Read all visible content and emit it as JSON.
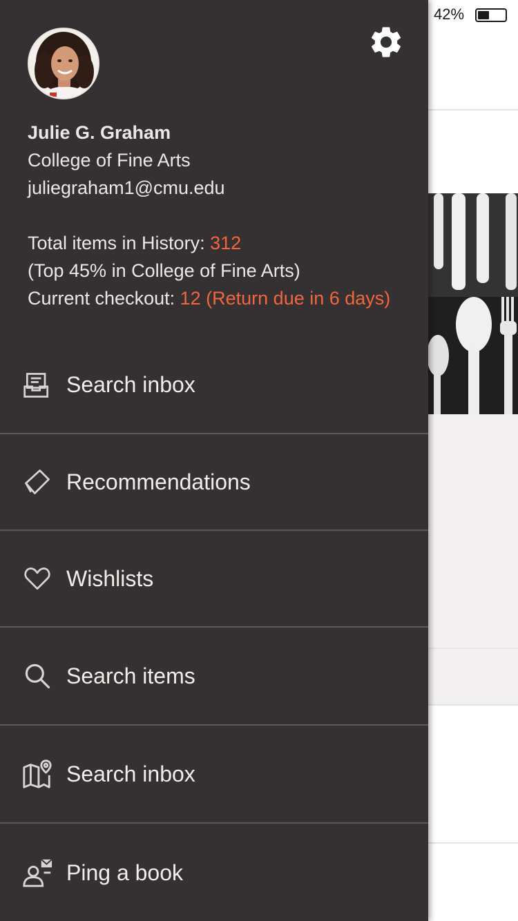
{
  "status_bar": {
    "battery_percent_text": "42%",
    "battery_level": 0.42
  },
  "drawer": {
    "settings_icon": "gear-icon",
    "profile": {
      "name": "Julie G. Graham",
      "college": "College of Fine Arts",
      "email": "juliegraham1@cmu.edu",
      "history_label": "Total items in History: ",
      "history_count": "312",
      "rank_text": "(Top 45% in College of Fine Arts)",
      "checkout_label": "Current checkout: ",
      "checkout_value": "12 (Return due in 6 days)"
    },
    "menu": [
      {
        "label": "Search inbox",
        "icon": "inbox-icon"
      },
      {
        "label": "Recommendations",
        "icon": "tag-icon"
      },
      {
        "label": "Wishlists",
        "icon": "heart-icon"
      },
      {
        "label": "Search items",
        "icon": "search-icon"
      },
      {
        "label": "Search inbox",
        "icon": "map-icon"
      },
      {
        "label": "Ping a book",
        "icon": "person-mail-icon"
      }
    ]
  },
  "colors": {
    "drawer_bg": "#353031",
    "accent": "#f2663f",
    "text": "#ebe8e8",
    "divider": "#5c5758"
  }
}
